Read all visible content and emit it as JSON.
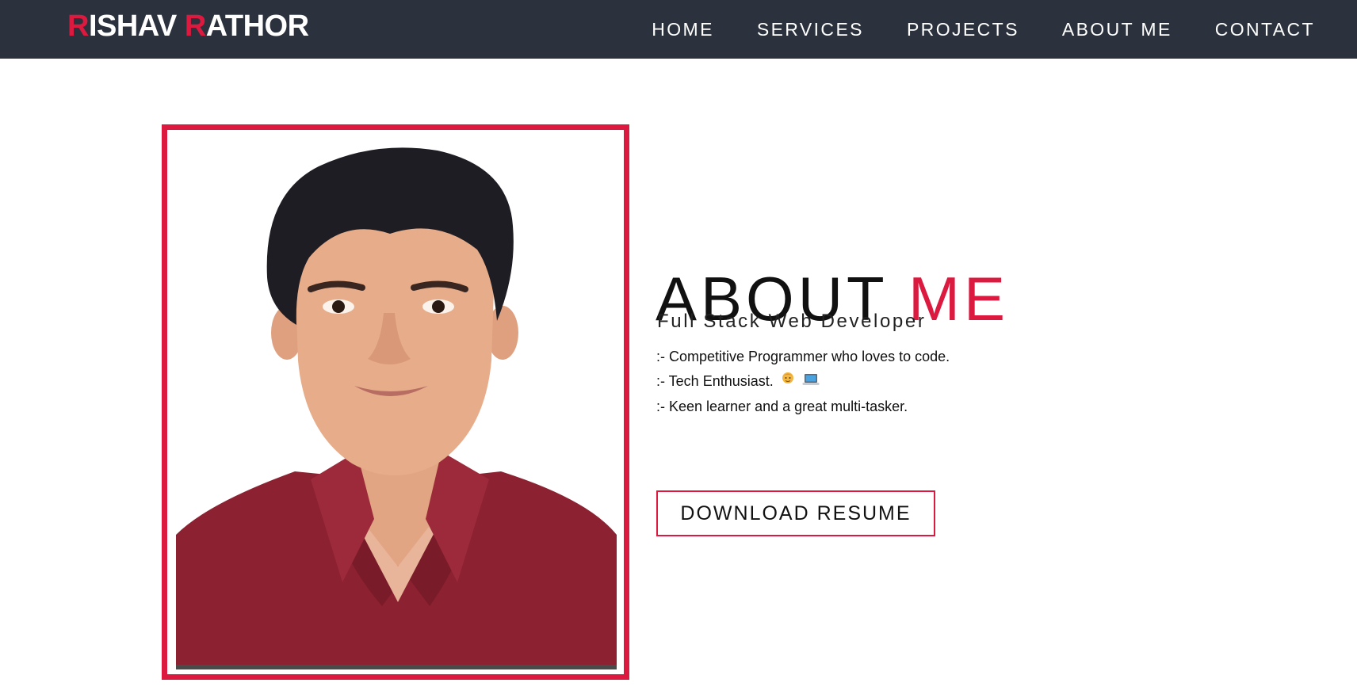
{
  "header": {
    "logo": {
      "first_initial": "R",
      "first_rest": "ISHAV ",
      "last_initial": "R",
      "last_rest": "ATHOR"
    },
    "nav": [
      "HOME",
      "SERVICES",
      "PROJECTS",
      "ABOUT ME",
      "CONTACT"
    ]
  },
  "about": {
    "title_main": "ABOUT ",
    "title_accent": "ME",
    "subtitle": "Full Stack Web Developer",
    "points": [
      ":- Competitive Programmer who loves to code.",
      ":- Tech Enthusiast.",
      ":- Keen learner and a great multi-tasker."
    ],
    "point_icons": [
      "man-technologist-emoji",
      "laptop-emoji"
    ],
    "resume_button": "DOWNLOAD RESUME"
  },
  "photo": {
    "alt": "profile-photo"
  },
  "colors": {
    "accent": "#dc1a3f",
    "navbar": "#2b323d",
    "background": "#ffffff"
  }
}
